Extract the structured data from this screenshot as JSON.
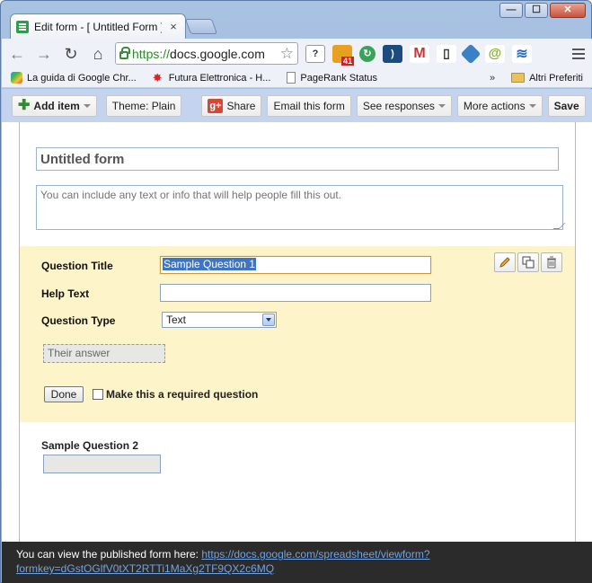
{
  "window": {
    "tab_title": "Edit form - [ Untitled Form ] - ",
    "tab_close": "×",
    "controls": {
      "minimize": "—",
      "maximize": "☐",
      "close": "✕"
    }
  },
  "toolbar": {
    "url_scheme": "https://",
    "url_host": "docs.google.com",
    "ext_badge": "41"
  },
  "bookmarks": {
    "items": [
      {
        "label": "La guida di Google Chr..."
      },
      {
        "label": "Futura Elettronica - H..."
      },
      {
        "label": "PageRank Status"
      }
    ],
    "more": "»",
    "other": "Altri Preferiti"
  },
  "appbar": {
    "add_item": "Add item",
    "theme": "Theme:  Plain",
    "share": "Share",
    "email": "Email this form",
    "see_responses": "See responses",
    "more_actions": "More actions",
    "save": "Save"
  },
  "form": {
    "title": "Untitled form",
    "description_placeholder": "You can include any text or info that will help people fill this out.",
    "editor": {
      "question_title_label": "Question Title",
      "question_title_value": "Sample Question 1",
      "help_text_label": "Help Text",
      "help_text_value": "",
      "question_type_label": "Question Type",
      "question_type_value": "Text",
      "answer_placeholder": "Their answer",
      "done": "Done",
      "required_label": "Make this a required question",
      "required_checked": false
    },
    "question2": {
      "title": "Sample Question 2"
    }
  },
  "footer": {
    "text": "You can view the published form here: ",
    "link_line1": "https://docs.google.com/spreadsheet/viewform?",
    "link_line2": "formkey=dGstOGlfV0tXT2RTTi1MaXg2TF9QX2c6MQ"
  }
}
